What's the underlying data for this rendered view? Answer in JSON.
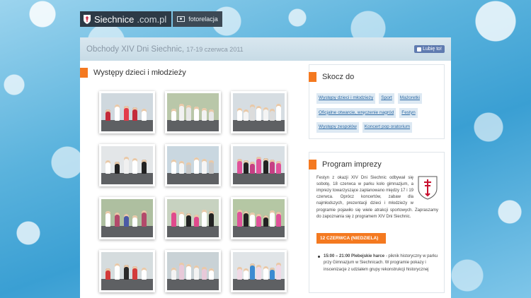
{
  "site": {
    "brand_name": "Siechnice",
    "brand_tld": ".com.pl",
    "gallery_link": "fotorelacja"
  },
  "header": {
    "title": "Obchody XIV Dni Siechnic,",
    "dates": "17-19 czerwca 2011",
    "like_label": "Lubię to!"
  },
  "gallery": {
    "section_title": "Występy dzieci i młodzieży",
    "thumbnails": [
      {
        "desc": "children-dancers-1"
      },
      {
        "desc": "karate-show-1"
      },
      {
        "desc": "karate-show-2"
      },
      {
        "desc": "karate-show-3"
      },
      {
        "desc": "choir-stage"
      },
      {
        "desc": "dancers-stage"
      },
      {
        "desc": "majorettes-1"
      },
      {
        "desc": "majorettes-2"
      },
      {
        "desc": "majorettes-3"
      },
      {
        "desc": "majorettes-4"
      },
      {
        "desc": "girls-dance"
      },
      {
        "desc": "children-stage"
      }
    ]
  },
  "jump": {
    "title": "Skocz do",
    "links": [
      "Występy dzieci i młodzieży",
      "Sport",
      "Mażoretki",
      "Oficjalne otwarcie, wręczenie nagród",
      "Festyn",
      "Występy zespołów",
      "Koncert pop oratorium"
    ]
  },
  "program": {
    "title": "Program imprezy",
    "text": "Festyn z okazji XIV Dni Siechnic odbywał się sobotę, 18 czerwca w parku koło gimnazjum, a imprezy towarzyszące zaplanowano między 17 i 19 czerwca. Oprócz koncertów, zabaw dla najmłodszych, prezentacji dzieci i młodzieży w programie pojawiło się wiele atrakcji sportowych. Zapraszamy do zapoznania się z programem XIV Dni Siechnic.",
    "date_label": "12 CZERWCA (NIEDZIELA)",
    "event_time": "15:00 – 21:00 Plebejskie harce",
    "event_text": " - piknik historyczny w parku przy Gimnazjum w Siechnicach. W programie pokazy i inscenizacje z udziałem grupy rekonstrukcji historycznej"
  },
  "colors": {
    "accent": "#f47920",
    "link": "#2d6aa4",
    "tag_bg": "#dde9f3",
    "header_bg": "#c7dbe6",
    "topbar_bg": "#2d3a46"
  }
}
